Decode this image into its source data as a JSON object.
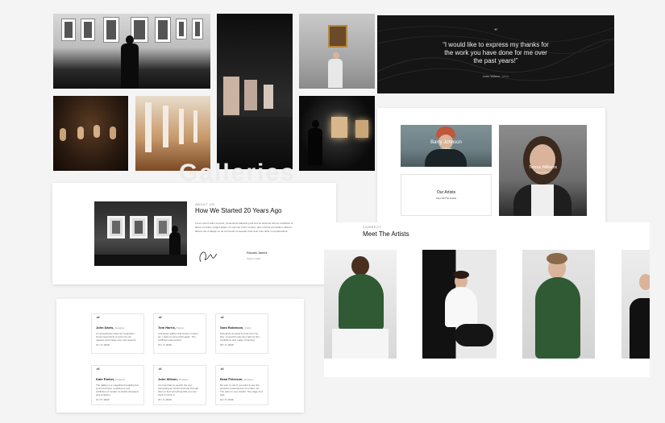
{
  "testimonial": {
    "quote_mark": "“",
    "line1": "“I would like to express my thanks for",
    "line2": "the work you have done for me over",
    "line3": "the past years!”",
    "author": "John Willem,",
    "author_role": "Artist"
  },
  "artist_tiles": {
    "barry_name": "Barry Johnson",
    "barry_role": "Landscape",
    "our_artists_title": "Our Artists",
    "our_artists_link": "View All The Artists",
    "tereza_name": "Tereza Williams",
    "tereza_role": "Photo Maker"
  },
  "about": {
    "eyebrow": "ABOUT US",
    "title": "How We Started 20 Years Ago",
    "body": "Lorem ipsum dolor sit amet, consectetur adipiscing elit sed do eiusmod tempor incididunt ut labore et dolore magna aliqua. Ut enim ad minim veniam, quis nostrud exercitation ullamco laboris nisi ut aliquip ex ea commodo consequat. Duis aute irure dolor in reprehenderit.",
    "signer_name": "Ronald James",
    "signer_role": "Owner, Coke"
  },
  "meet": {
    "eyebrow": "CONNECT",
    "title": "Meet The Artists"
  },
  "watermark": "Galleries",
  "testimonials": [
    {
      "name": "John Davis,",
      "role": "Designer",
      "text": "An atmospheric place for inspiration. Great opportunity to look into old masters and create your own artwork.",
      "date": "12 / 2 / 2019"
    },
    {
      "name": "Tom Harris,",
      "role": "Painter",
      "text": "A fantastic gallery that shows modern art. I want to come back again. The exhibition was perfect.",
      "date": "16 / 4 / 2019"
    },
    {
      "name": "Sara Robinson,",
      "role": "Visitor",
      "text": "Absolutely amazed by how the time flew. I loved the way they laid out the exhibitions and made it inspiring.",
      "date": "18 / 3 / 2019"
    },
    {
      "name": "Kate Parker,",
      "role": "Designer",
      "text": "The gallery is a magnificent building full of art and there is always a new exhibition of modern & artistic designers and sculptors.",
      "date": "11 / 5 / 2019"
    },
    {
      "name": "John Wilson,",
      "role": "Designer",
      "text": "It is important to search the very interesting art works and look through them to find something that you can want to frame it.",
      "date": "22 / 4 / 2019"
    },
    {
      "name": "Brad Peterson,",
      "role": "Designer",
      "text": "Be sure to visit if you want to see the greatest masterpieces of modern art. The team is very helpful. The stage and wait.",
      "date": "12 / 6 / 2019"
    }
  ]
}
